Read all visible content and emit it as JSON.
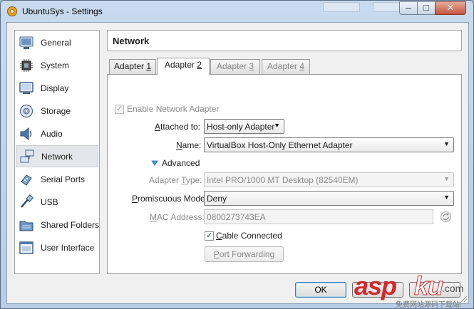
{
  "window": {
    "title": "UbuntuSys - Settings"
  },
  "sidebar": {
    "items": [
      {
        "label": "General",
        "icon": "general-icon"
      },
      {
        "label": "System",
        "icon": "system-icon"
      },
      {
        "label": "Display",
        "icon": "display-icon"
      },
      {
        "label": "Storage",
        "icon": "storage-icon"
      },
      {
        "label": "Audio",
        "icon": "audio-icon"
      },
      {
        "label": "Network",
        "icon": "network-icon",
        "selected": true
      },
      {
        "label": "Serial Ports",
        "icon": "serial-ports-icon"
      },
      {
        "label": "USB",
        "icon": "usb-icon"
      },
      {
        "label": "Shared Folders",
        "icon": "shared-folders-icon"
      },
      {
        "label": "User Interface",
        "icon": "user-interface-icon"
      }
    ]
  },
  "header": {
    "title": "Network"
  },
  "tabs": [
    {
      "prefix": "Adapter ",
      "key": "1",
      "state": "normal"
    },
    {
      "prefix": "Adapter ",
      "key": "2",
      "state": "active"
    },
    {
      "prefix": "Adapter ",
      "key": "3",
      "state": "disabled"
    },
    {
      "prefix": "Adapter ",
      "key": "4",
      "state": "disabled"
    }
  ],
  "form": {
    "enable_adapter": {
      "label": "Enable Network Adapter",
      "checked": true,
      "disabled": true
    },
    "attached_to": {
      "label_key": "A",
      "label_rest": "ttached to:",
      "value": "Host-only Adapter"
    },
    "name": {
      "label_key": "N",
      "label_rest": "ame:",
      "value": "VirtualBox Host-Only Ethernet Adapter"
    },
    "advanced": {
      "label": "Advanced",
      "expanded": true
    },
    "adapter_type": {
      "label_pre": "Adapter ",
      "label_key": "T",
      "label_rest": "ype:",
      "value": "Intel PRO/1000 MT Desktop (82540EM)"
    },
    "promiscuous": {
      "label_key": "P",
      "label_rest": "romiscuous Mode:",
      "value": "Deny"
    },
    "mac": {
      "label_pre": "",
      "label_key": "M",
      "label_rest": "AC Address:",
      "value": "0800273743EA"
    },
    "cable": {
      "label_key": "C",
      "label_rest": "able Connected",
      "checked": true
    },
    "port_forwarding": {
      "label_key": "P",
      "label_rest": "ort Forwarding"
    }
  },
  "buttons": {
    "ok": "OK"
  },
  "watermark": {
    "asp": "asp",
    "ku": "ku",
    "com": ".com",
    "sub": "免费网站源码下载站!"
  },
  "colors": {
    "accent": "#3c7fb1",
    "titlebar": "#c9daee",
    "watermark": "#d7272a"
  }
}
